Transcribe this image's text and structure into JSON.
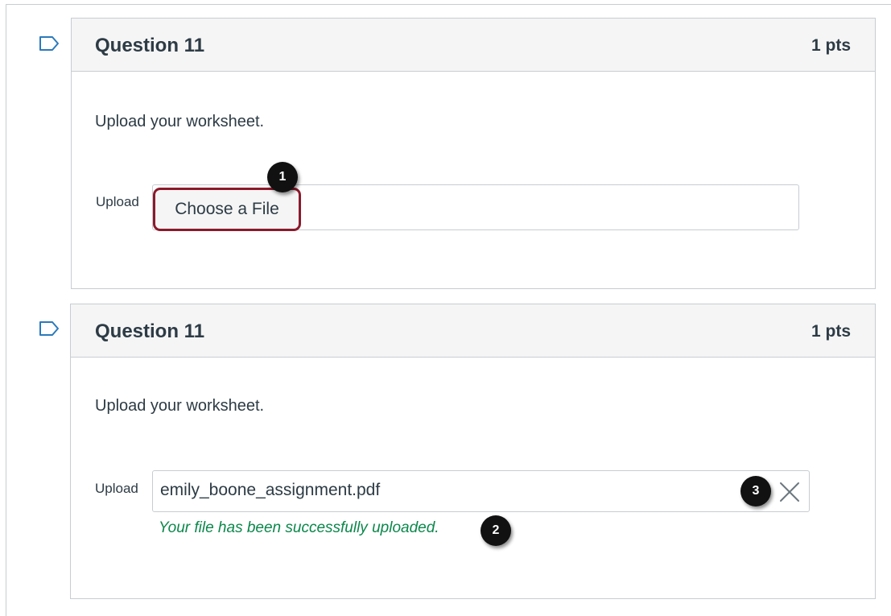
{
  "questions": [
    {
      "title": "Question 11",
      "points": "1 pts",
      "prompt": "Upload your worksheet.",
      "upload_label": "Upload",
      "choose_button_label": "Choose a File",
      "callout": "1"
    },
    {
      "title": "Question 11",
      "points": "1 pts",
      "prompt": "Upload your worksheet.",
      "upload_label": "Upload",
      "file_name": "emily_boone_assignment.pdf",
      "success_message": "Your file has been successfully uploaded.",
      "callout_success": "2",
      "callout_remove": "3"
    }
  ],
  "icons": {
    "flag": "flag-icon",
    "remove": "close-icon"
  },
  "colors": {
    "header_bg": "#f5f5f5",
    "border": "#c7cdd1",
    "text": "#2d3b45",
    "success": "#0b874b",
    "highlight": "#8b1a2b",
    "callout_bg": "#111111"
  }
}
